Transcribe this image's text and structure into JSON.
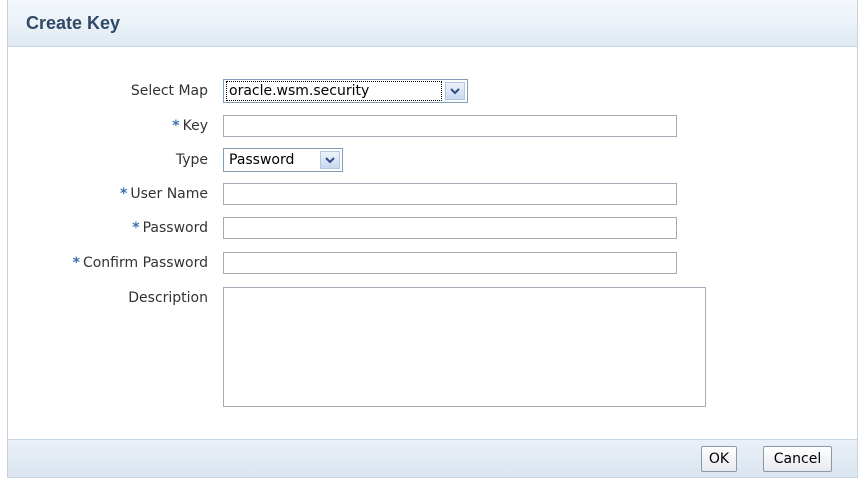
{
  "dialog": {
    "title": "Create Key"
  },
  "form": {
    "select_map": {
      "label": "Select Map",
      "value": "oracle.wsm.security"
    },
    "key": {
      "label": "Key",
      "value": "",
      "required": true
    },
    "type": {
      "label": "Type",
      "value": "Password"
    },
    "user_name": {
      "label": "User Name",
      "value": "",
      "required": true
    },
    "password": {
      "label": "Password",
      "value": "",
      "required": true
    },
    "confirm_password": {
      "label": "Confirm Password",
      "value": "",
      "required": true
    },
    "description": {
      "label": "Description",
      "value": ""
    },
    "required_marker": "*"
  },
  "footer": {
    "ok_label": "OK",
    "cancel_label": "Cancel"
  },
  "icons": {
    "dropdown": "chevron-down-icon"
  },
  "colors": {
    "title": "#2f4a67",
    "required_marker": "#3b6fb0",
    "header_bg": "#e9f0f7"
  }
}
